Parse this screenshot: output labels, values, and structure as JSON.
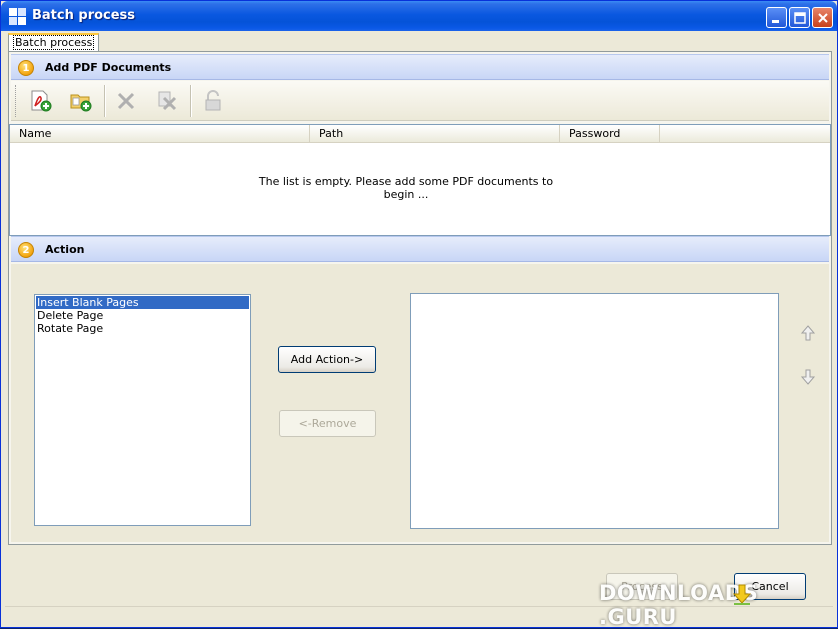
{
  "window": {
    "title": "Batch process"
  },
  "tab": {
    "label": "Batch process"
  },
  "section1": {
    "number": "1",
    "title": "Add PDF Documents"
  },
  "toolbar": {
    "icons": [
      "add-pdf-icon",
      "add-folder-icon",
      "delete-icon",
      "remove-all-icon",
      "unlock-icon"
    ]
  },
  "file_list": {
    "columns": [
      "Name",
      "Path",
      "Password"
    ],
    "empty_message": "The list is empty. Please add some PDF documents to begin ..."
  },
  "section2": {
    "number": "2",
    "title": "Action"
  },
  "actions": {
    "available": [
      "Insert Blank Pages",
      "Delete Page",
      "Rotate Page"
    ],
    "selected_index": 0,
    "add_button": "Add Action->",
    "remove_button": "<-Remove"
  },
  "footer": {
    "process_button": "Process",
    "cancel_button": "Cancel"
  },
  "watermark": {
    "text": "DOWNLOADS",
    "suffix": ".GURU"
  },
  "colors": {
    "titlebar": "#0a58e0",
    "selection": "#316ac5",
    "section_header": "#c8d6f6",
    "badge": "#f3a40f"
  }
}
